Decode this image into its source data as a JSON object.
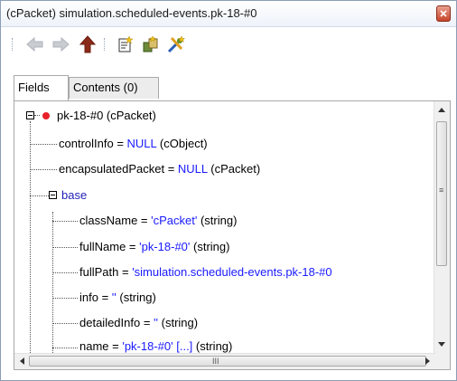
{
  "window": {
    "title": "(cPacket) simulation.scheduled-events.pk-18-#0"
  },
  "toolbar": {
    "buttons": [
      {
        "name": "back",
        "icon": "back-arrow-icon"
      },
      {
        "name": "forward",
        "icon": "forward-arrow-icon"
      },
      {
        "name": "up",
        "icon": "up-arrow-icon"
      },
      {
        "name": "copy",
        "icon": "copy-document-icon"
      },
      {
        "name": "inspect",
        "icon": "inspect-object-icon"
      },
      {
        "name": "tools",
        "icon": "tools-icon"
      }
    ]
  },
  "tabs": [
    {
      "label": "Fields",
      "active": true
    },
    {
      "label": "Contents (0)",
      "active": false
    }
  ],
  "tree": {
    "root": "pk-18-#0 (cPacket)",
    "items": [
      {
        "name": "controlInfo = ",
        "value": "NULL",
        "suffix": " (cObject)"
      },
      {
        "name": "encapsulatedPacket = ",
        "value": "NULL",
        "suffix": " (cPacket)"
      },
      {
        "label": "base"
      },
      {
        "name": "className = ",
        "value": "'cPacket'",
        "suffix": " (string)"
      },
      {
        "name": "fullName = ",
        "value": "'pk-18-#0'",
        "suffix": " (string)"
      },
      {
        "name": "fullPath = ",
        "value": "'simulation.scheduled-events.pk-18-#0",
        "suffix": ""
      },
      {
        "name": "info = ",
        "value": "''",
        "suffix": " (string)"
      },
      {
        "name": "detailedInfo = ",
        "value": "''",
        "suffix": " (string)"
      },
      {
        "name": "name = ",
        "value": "'pk-18-#0' [...]",
        "suffix": " (string)"
      }
    ]
  },
  "scrollbar": {
    "hgrip": "III",
    "vgrip": "≡"
  },
  "colors": {
    "value": "#1a1aff",
    "base_label": "#1f1fb8",
    "marker": "#e8202a"
  }
}
